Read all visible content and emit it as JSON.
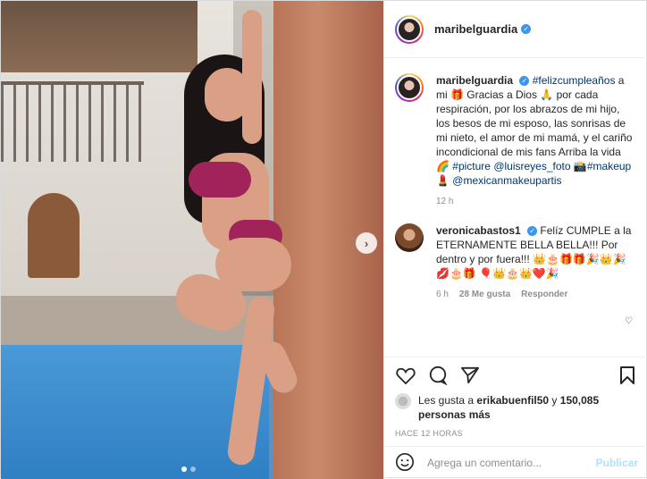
{
  "post": {
    "username": "maribelguardia",
    "verified_icon": "verified-badge-icon",
    "caption_user": "maribelguardia",
    "caption_parts": [
      {
        "t": "#felizcumpleaños",
        "link": true
      },
      {
        "t": " a mi 🎁 Gracias a Dios 🙏 por cada respiración, por los abrazos de mi hijo, los besos de mi esposo, las sonrisas de mi nieto, el amor de mi mamá, y el cariño incondicional de mis fans Arriba la vida 🌈 ",
        "link": false
      },
      {
        "t": "#picture",
        "link": true
      },
      {
        "t": " ",
        "link": false
      },
      {
        "t": "@luisreyes_foto",
        "link": true
      },
      {
        "t": " 📸",
        "link": false
      },
      {
        "t": "#makeup",
        "link": true
      },
      {
        "t": " 💄 ",
        "link": false
      },
      {
        "t": "@mexicanmakeupartis",
        "link": true
      }
    ],
    "caption_time": "12 h"
  },
  "comment": {
    "username": "veronicabastos1",
    "text": " Felíz CUMPLE a la ETERNAMENTE BELLA BELLA!!! Por dentro y por fuera!!! 👑🎂🎁🎁🎉👑🎉💋🎂🎁 🎈👑🎂👑❤️🎉",
    "time": "6 h",
    "likes": "28 Me gusta",
    "reply": "Responder"
  },
  "likes": {
    "prefix": "Les gusta a ",
    "user": "erikabuenfil50",
    "middle": " y ",
    "count": "150,085 personas más"
  },
  "timestamp": "HACE 12 HORAS",
  "add_comment": {
    "placeholder": "Agrega un comentario...",
    "post_label": "Publicar"
  },
  "carousel": {
    "current": 1,
    "total": 2
  },
  "colors": {
    "link": "#00376b",
    "verified": "#3897f0",
    "publish": "#b2dffc"
  }
}
